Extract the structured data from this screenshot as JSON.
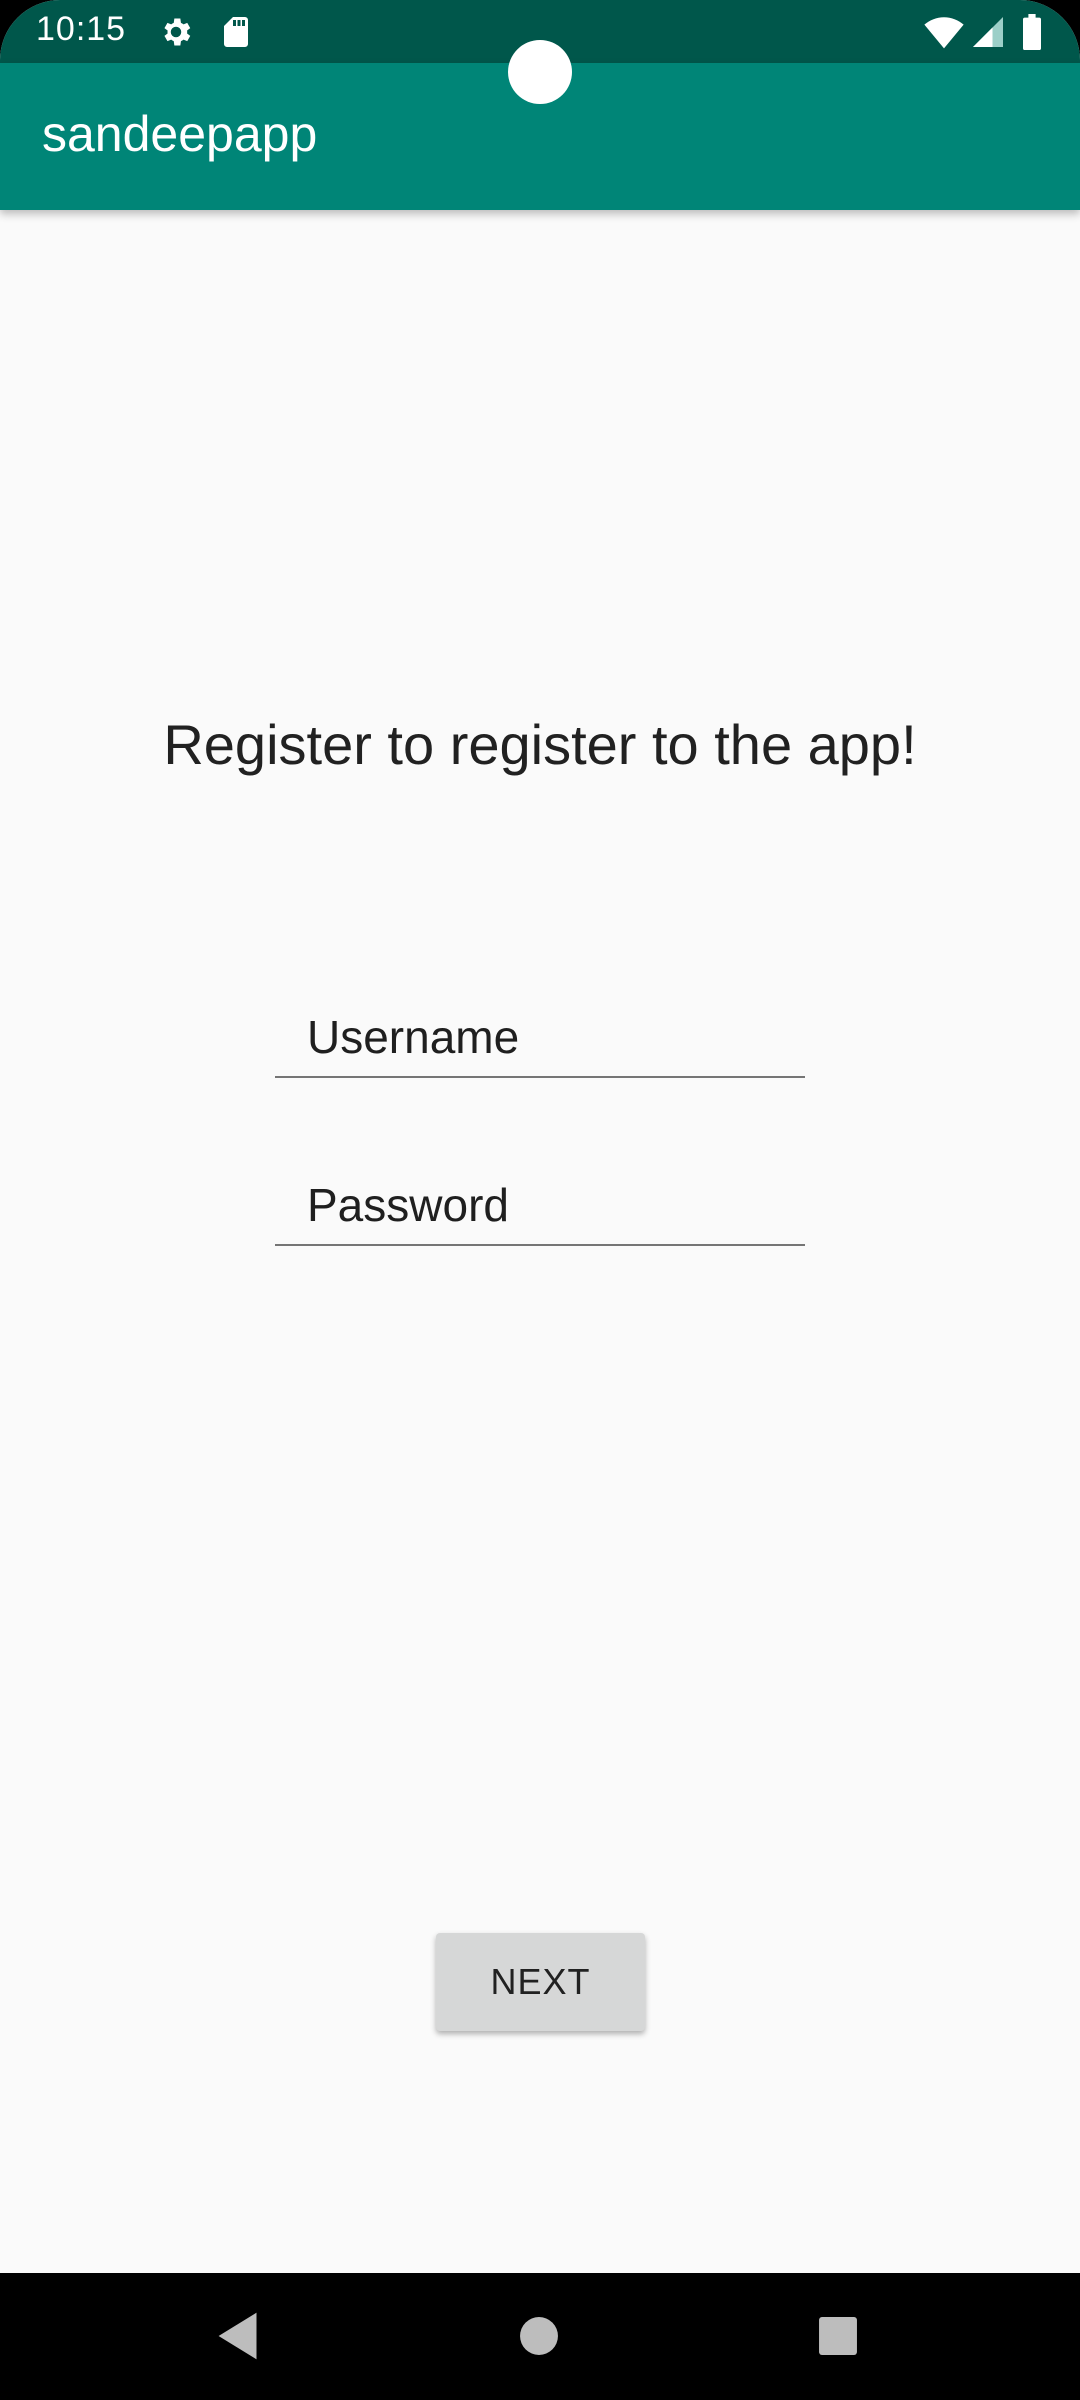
{
  "status_bar": {
    "time": "10:15",
    "icons": [
      "settings-icon",
      "sd-card-icon",
      "wifi-icon",
      "cell-signal-icon",
      "battery-icon"
    ]
  },
  "app_bar": {
    "title": "sandeepapp"
  },
  "main": {
    "heading": "Register to register to the app!",
    "username_placeholder": "Username",
    "password_placeholder": "Password",
    "next_label": "NEXT"
  },
  "nav_bar": {
    "icons": [
      "back-icon",
      "home-icon",
      "recents-icon"
    ]
  },
  "colors": {
    "status_bar": "#00574b",
    "app_bar": "#008577",
    "background": "#fafafa",
    "button": "#d6d7d7"
  }
}
